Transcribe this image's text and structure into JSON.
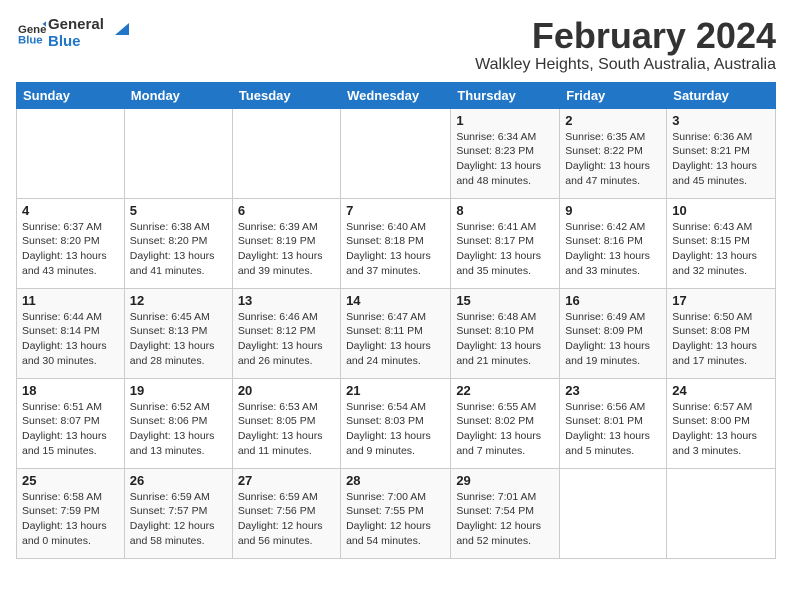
{
  "app": {
    "name_general": "General",
    "name_blue": "Blue"
  },
  "header": {
    "month": "February 2024",
    "location": "Walkley Heights, South Australia, Australia"
  },
  "weekdays": [
    "Sunday",
    "Monday",
    "Tuesday",
    "Wednesday",
    "Thursday",
    "Friday",
    "Saturday"
  ],
  "weeks": [
    [
      {
        "num": "",
        "detail": ""
      },
      {
        "num": "",
        "detail": ""
      },
      {
        "num": "",
        "detail": ""
      },
      {
        "num": "",
        "detail": ""
      },
      {
        "num": "1",
        "detail": "Sunrise: 6:34 AM\nSunset: 8:23 PM\nDaylight: 13 hours\nand 48 minutes."
      },
      {
        "num": "2",
        "detail": "Sunrise: 6:35 AM\nSunset: 8:22 PM\nDaylight: 13 hours\nand 47 minutes."
      },
      {
        "num": "3",
        "detail": "Sunrise: 6:36 AM\nSunset: 8:21 PM\nDaylight: 13 hours\nand 45 minutes."
      }
    ],
    [
      {
        "num": "4",
        "detail": "Sunrise: 6:37 AM\nSunset: 8:20 PM\nDaylight: 13 hours\nand 43 minutes."
      },
      {
        "num": "5",
        "detail": "Sunrise: 6:38 AM\nSunset: 8:20 PM\nDaylight: 13 hours\nand 41 minutes."
      },
      {
        "num": "6",
        "detail": "Sunrise: 6:39 AM\nSunset: 8:19 PM\nDaylight: 13 hours\nand 39 minutes."
      },
      {
        "num": "7",
        "detail": "Sunrise: 6:40 AM\nSunset: 8:18 PM\nDaylight: 13 hours\nand 37 minutes."
      },
      {
        "num": "8",
        "detail": "Sunrise: 6:41 AM\nSunset: 8:17 PM\nDaylight: 13 hours\nand 35 minutes."
      },
      {
        "num": "9",
        "detail": "Sunrise: 6:42 AM\nSunset: 8:16 PM\nDaylight: 13 hours\nand 33 minutes."
      },
      {
        "num": "10",
        "detail": "Sunrise: 6:43 AM\nSunset: 8:15 PM\nDaylight: 13 hours\nand 32 minutes."
      }
    ],
    [
      {
        "num": "11",
        "detail": "Sunrise: 6:44 AM\nSunset: 8:14 PM\nDaylight: 13 hours\nand 30 minutes."
      },
      {
        "num": "12",
        "detail": "Sunrise: 6:45 AM\nSunset: 8:13 PM\nDaylight: 13 hours\nand 28 minutes."
      },
      {
        "num": "13",
        "detail": "Sunrise: 6:46 AM\nSunset: 8:12 PM\nDaylight: 13 hours\nand 26 minutes."
      },
      {
        "num": "14",
        "detail": "Sunrise: 6:47 AM\nSunset: 8:11 PM\nDaylight: 13 hours\nand 24 minutes."
      },
      {
        "num": "15",
        "detail": "Sunrise: 6:48 AM\nSunset: 8:10 PM\nDaylight: 13 hours\nand 21 minutes."
      },
      {
        "num": "16",
        "detail": "Sunrise: 6:49 AM\nSunset: 8:09 PM\nDaylight: 13 hours\nand 19 minutes."
      },
      {
        "num": "17",
        "detail": "Sunrise: 6:50 AM\nSunset: 8:08 PM\nDaylight: 13 hours\nand 17 minutes."
      }
    ],
    [
      {
        "num": "18",
        "detail": "Sunrise: 6:51 AM\nSunset: 8:07 PM\nDaylight: 13 hours\nand 15 minutes."
      },
      {
        "num": "19",
        "detail": "Sunrise: 6:52 AM\nSunset: 8:06 PM\nDaylight: 13 hours\nand 13 minutes."
      },
      {
        "num": "20",
        "detail": "Sunrise: 6:53 AM\nSunset: 8:05 PM\nDaylight: 13 hours\nand 11 minutes."
      },
      {
        "num": "21",
        "detail": "Sunrise: 6:54 AM\nSunset: 8:03 PM\nDaylight: 13 hours\nand 9 minutes."
      },
      {
        "num": "22",
        "detail": "Sunrise: 6:55 AM\nSunset: 8:02 PM\nDaylight: 13 hours\nand 7 minutes."
      },
      {
        "num": "23",
        "detail": "Sunrise: 6:56 AM\nSunset: 8:01 PM\nDaylight: 13 hours\nand 5 minutes."
      },
      {
        "num": "24",
        "detail": "Sunrise: 6:57 AM\nSunset: 8:00 PM\nDaylight: 13 hours\nand 3 minutes."
      }
    ],
    [
      {
        "num": "25",
        "detail": "Sunrise: 6:58 AM\nSunset: 7:59 PM\nDaylight: 13 hours\nand 0 minutes."
      },
      {
        "num": "26",
        "detail": "Sunrise: 6:59 AM\nSunset: 7:57 PM\nDaylight: 12 hours\nand 58 minutes."
      },
      {
        "num": "27",
        "detail": "Sunrise: 6:59 AM\nSunset: 7:56 PM\nDaylight: 12 hours\nand 56 minutes."
      },
      {
        "num": "28",
        "detail": "Sunrise: 7:00 AM\nSunset: 7:55 PM\nDaylight: 12 hours\nand 54 minutes."
      },
      {
        "num": "29",
        "detail": "Sunrise: 7:01 AM\nSunset: 7:54 PM\nDaylight: 12 hours\nand 52 minutes."
      },
      {
        "num": "",
        "detail": ""
      },
      {
        "num": "",
        "detail": ""
      }
    ]
  ]
}
